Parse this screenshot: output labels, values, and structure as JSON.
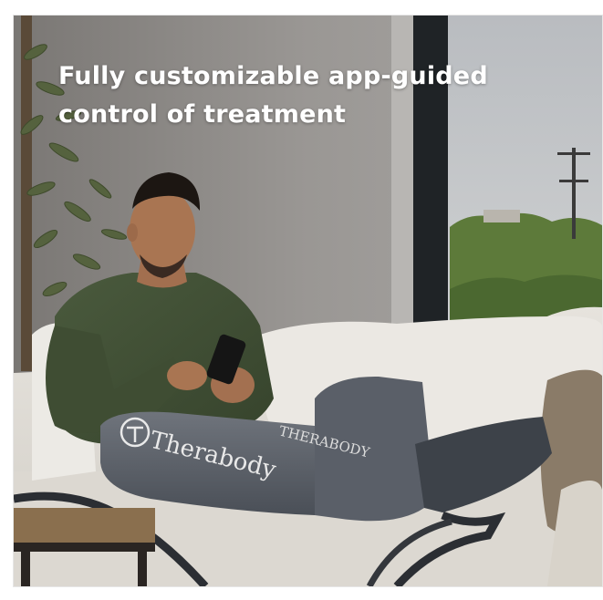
{
  "image": {
    "subject": "Man on sofa using phone while wearing a compression leg boot",
    "headline": {
      "line1": "Fully customizable app-guided",
      "line2": "control of treatment"
    },
    "boot_brand": "Therabody",
    "boot_partial_text": "THERABODY"
  }
}
